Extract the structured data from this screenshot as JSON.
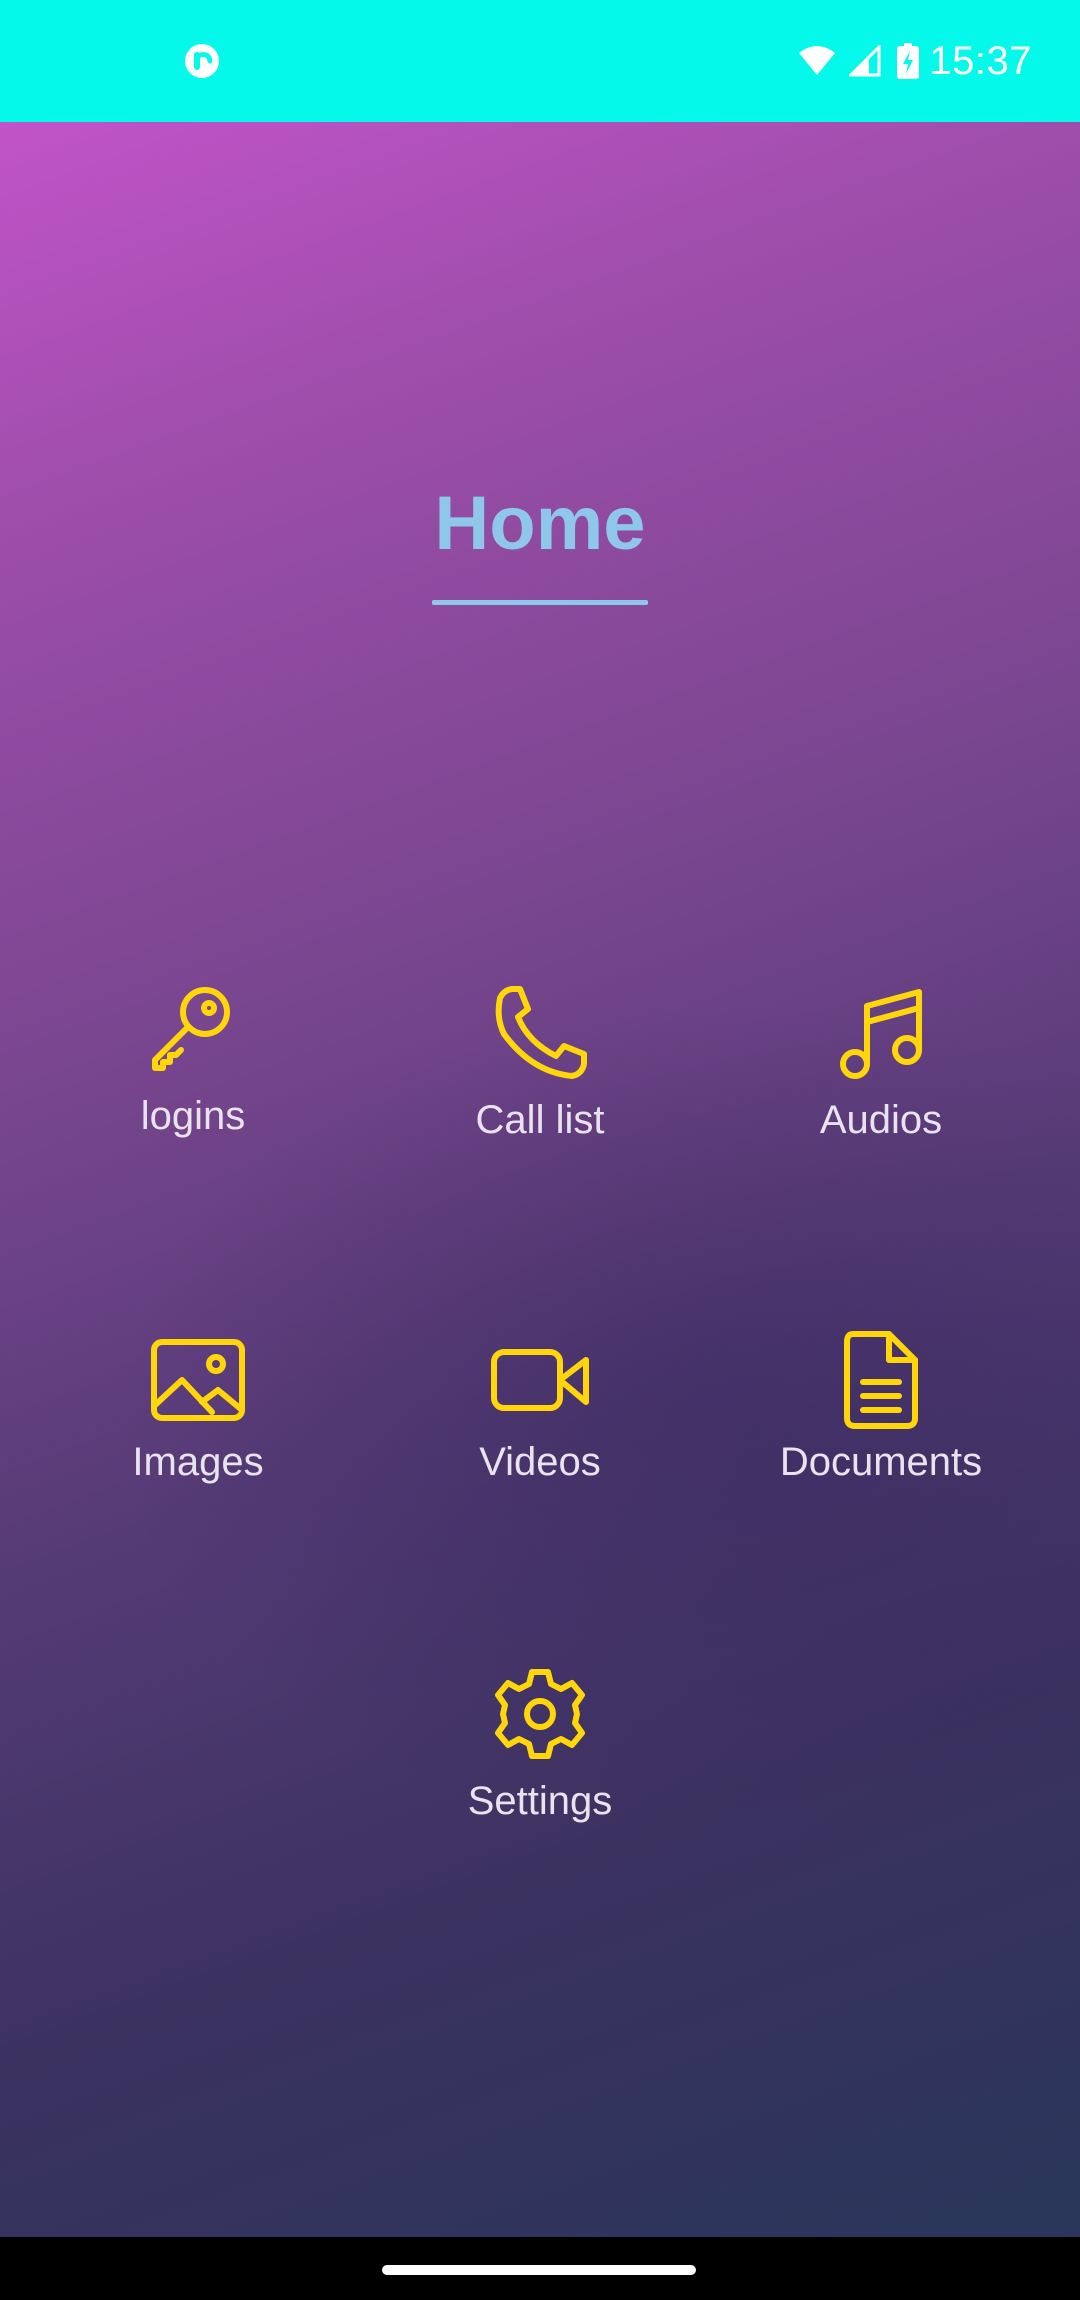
{
  "status_bar": {
    "time": "15:37",
    "icons": [
      "app-notification-icon",
      "wifi-icon",
      "cellular-signal-icon",
      "battery-charging-icon"
    ],
    "background_color": "#05f9ea"
  },
  "page": {
    "title": "Home",
    "title_color": "#8ec7ea",
    "icon_color": "#ffd60a"
  },
  "menu": {
    "items": [
      {
        "label": "logins",
        "icon": "key-icon"
      },
      {
        "label": "Call list",
        "icon": "phone-icon"
      },
      {
        "label": "Audios",
        "icon": "music-note-icon"
      },
      {
        "label": "Images",
        "icon": "image-icon"
      },
      {
        "label": "Videos",
        "icon": "video-camera-icon"
      },
      {
        "label": "Documents",
        "icon": "document-icon"
      },
      {
        "label": "Settings",
        "icon": "gear-icon"
      }
    ]
  },
  "navigation_bar": {
    "handle": "gesture-home-handle"
  }
}
